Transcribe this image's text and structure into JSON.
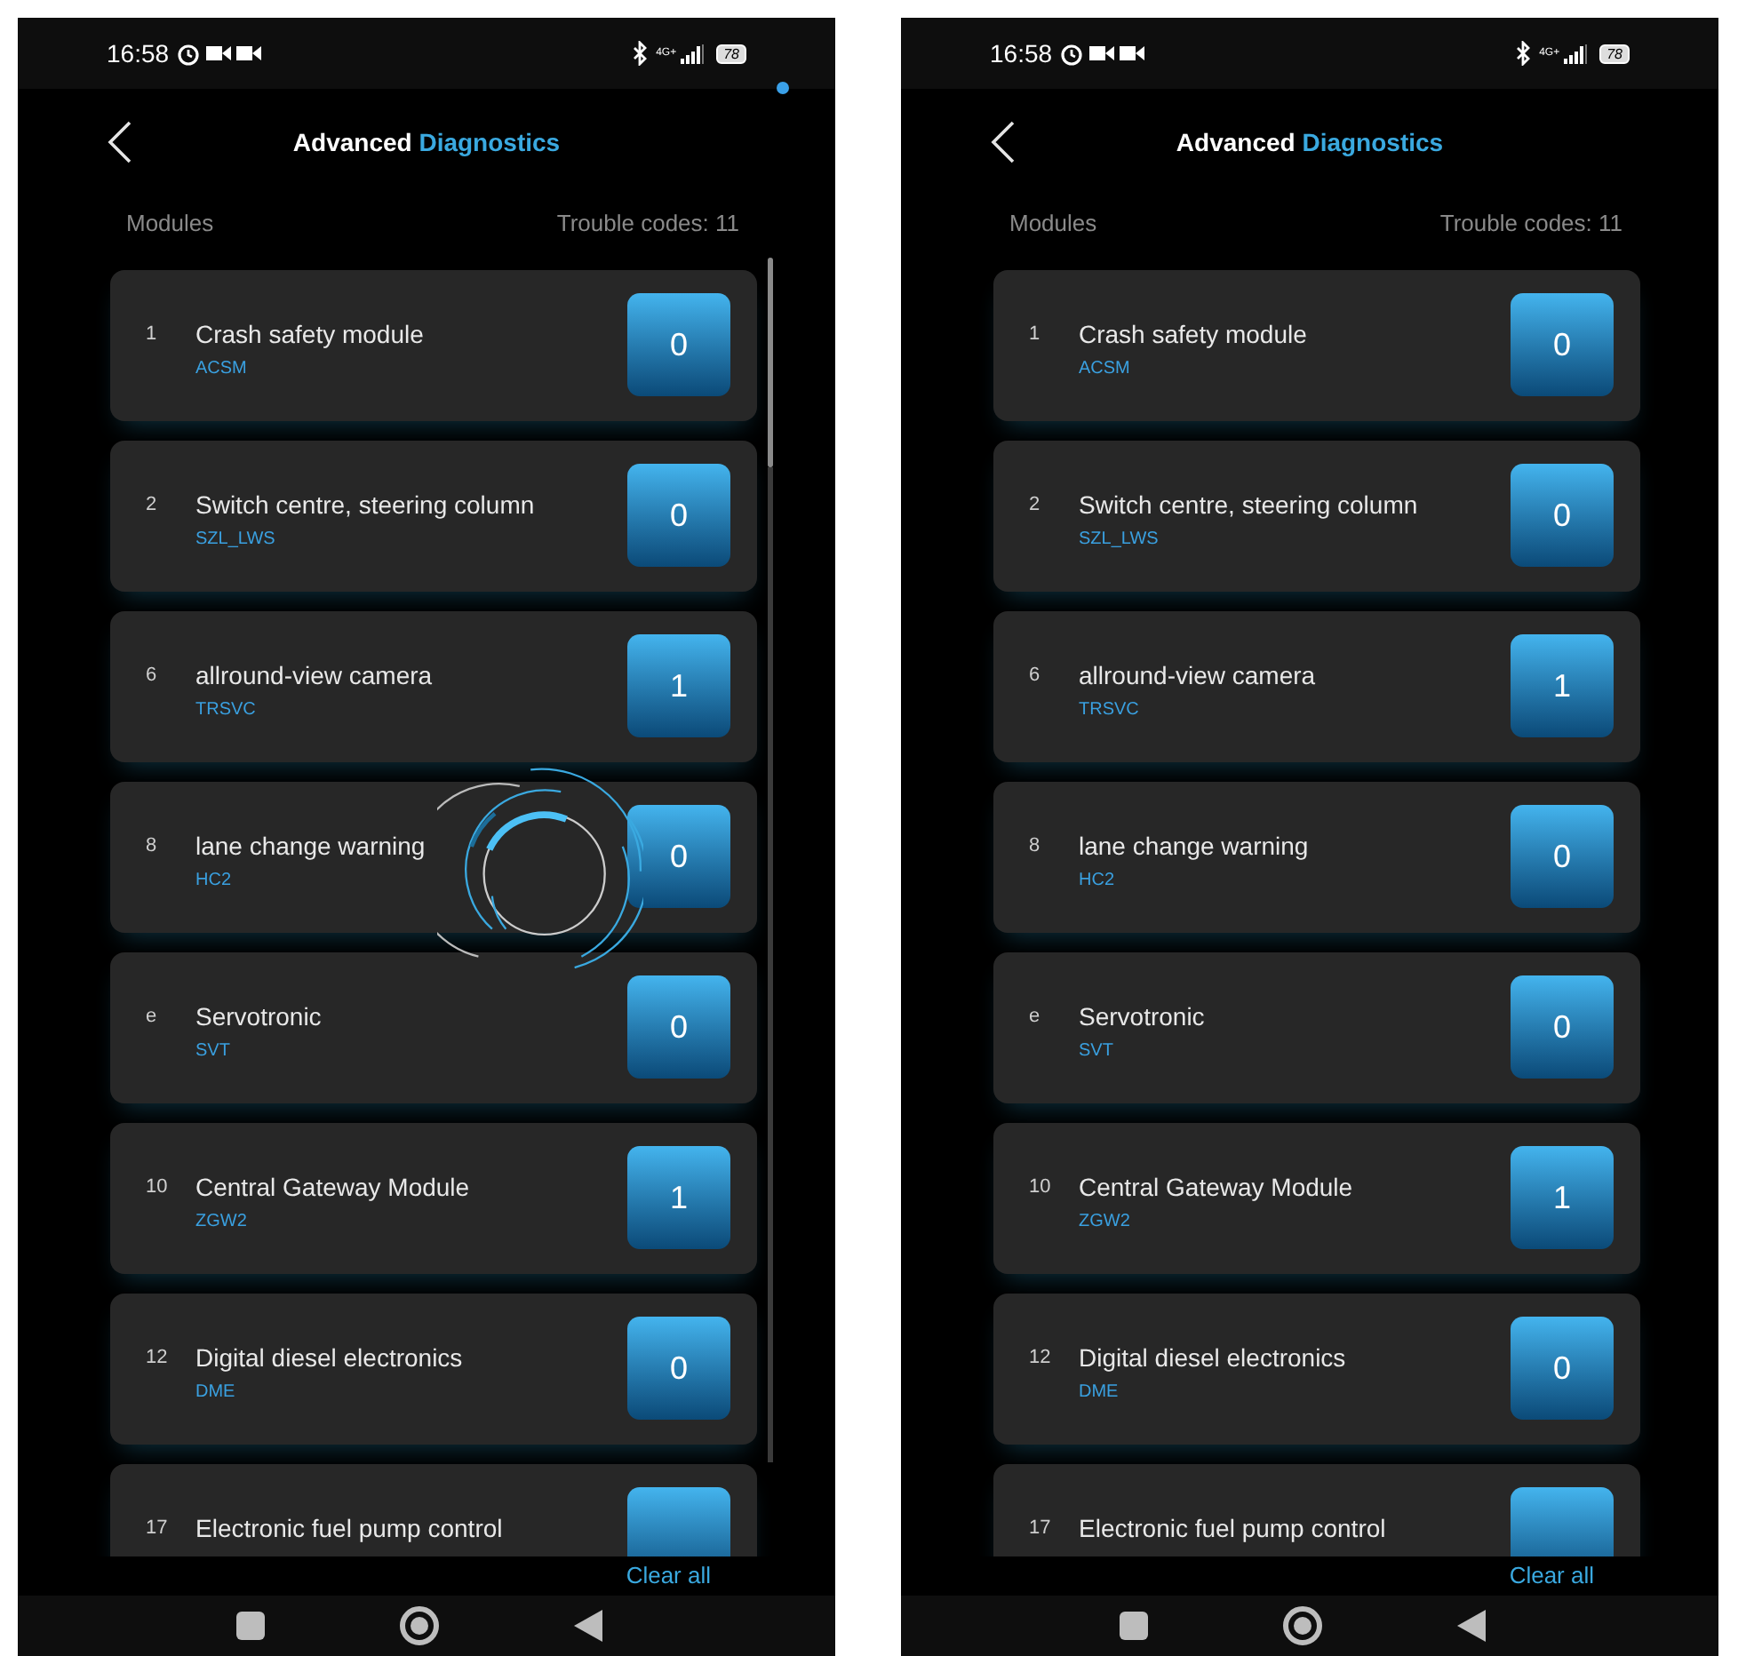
{
  "screens": [
    {
      "status_bar": {
        "time": "16:58",
        "network": "4G+",
        "battery": "78"
      },
      "notification_dot": true,
      "title": {
        "main": "Advanced",
        "accent": "Diagnostics"
      },
      "modules_label": "Modules",
      "trouble_codes": "Trouble codes: 11",
      "loading": true,
      "scrollbar": true,
      "modules": [
        {
          "number": "1",
          "name": "Crash safety module",
          "code": "ACSM",
          "count": "0"
        },
        {
          "number": "2",
          "name": "Switch centre, steering column",
          "code": "SZL_LWS",
          "count": "0"
        },
        {
          "number": "6",
          "name": "allround-view camera",
          "code": "TRSVC",
          "count": "1"
        },
        {
          "number": "8",
          "name": "lane change warning",
          "code": "HC2",
          "count": "0"
        },
        {
          "number": "e",
          "name": "Servotronic",
          "code": "SVT",
          "count": "0"
        },
        {
          "number": "10",
          "name": "Central Gateway Module",
          "code": "ZGW2",
          "count": "1"
        },
        {
          "number": "12",
          "name": "Digital diesel electronics",
          "code": "DME",
          "count": "0"
        },
        {
          "number": "17",
          "name": "Electronic fuel pump control"
        }
      ],
      "clear_all": "Clear all"
    },
    {
      "status_bar": {
        "time": "16:58",
        "network": "4G+",
        "battery": "78"
      },
      "notification_dot": false,
      "title": {
        "main": "Advanced",
        "accent": "Diagnostics"
      },
      "modules_label": "Modules",
      "trouble_codes": "Trouble codes: 11",
      "loading": false,
      "scrollbar": false,
      "modules": [
        {
          "number": "1",
          "name": "Crash safety module",
          "code": "ACSM",
          "count": "0"
        },
        {
          "number": "2",
          "name": "Switch centre, steering column",
          "code": "SZL_LWS",
          "count": "0"
        },
        {
          "number": "6",
          "name": "allround-view camera",
          "code": "TRSVC",
          "count": "1"
        },
        {
          "number": "8",
          "name": "lane change warning",
          "code": "HC2",
          "count": "0"
        },
        {
          "number": "e",
          "name": "Servotronic",
          "code": "SVT",
          "count": "0"
        },
        {
          "number": "10",
          "name": "Central Gateway Module",
          "code": "ZGW2",
          "count": "1"
        },
        {
          "number": "12",
          "name": "Digital diesel electronics",
          "code": "DME",
          "count": "0"
        },
        {
          "number": "17",
          "name": "Electronic fuel pump control"
        }
      ],
      "clear_all": "Clear all"
    }
  ]
}
